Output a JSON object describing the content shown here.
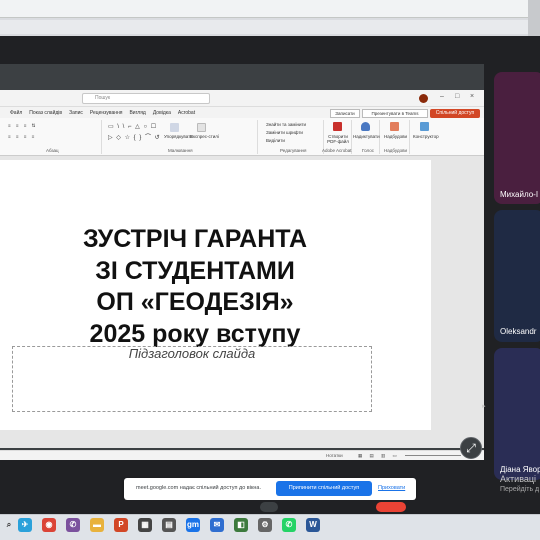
{
  "ppt": {
    "search_placeholder": "Пошук",
    "menu": [
      "Файл",
      "Показ слайдів",
      "Запис",
      "Рецензування",
      "Вигляд",
      "Довідка",
      "Acrobat"
    ],
    "record_label": "Записати",
    "present_teams_label": "Презентувати в Teams",
    "share_label": "Спільний доступ",
    "ribbon": {
      "paragraph_label": "Абзац",
      "drawing_label": "Малювання",
      "arrange_label": "Упорядкувати",
      "quick_styles_label": "Експрес-стилі",
      "find_replace": "Знайти та замінити",
      "replace_fonts": "Замінити шрифти",
      "select": "Виділити",
      "editing_label": "Редагування",
      "create_pdf": "Створити PDF-файл",
      "adobe_label": "Adobe Acrobat",
      "dictate": "Надиктувати",
      "voice_label": "Голос",
      "addins": "Надбудови",
      "addins_group": "Надбудови",
      "designer": "Конструктор"
    },
    "slide_title_lines": [
      "ЗУСТРІЧ ГАРАНТА",
      "ЗІ СТУДЕНТАМИ",
      "ОП «ГЕОДЕЗІЯ»",
      "2025 року вступу"
    ],
    "subtitle_placeholder": "Підзаголовок слайда",
    "status_notes": "Нотатки"
  },
  "participants": [
    {
      "name": "Михайло-І",
      "color": "#4a1f3f"
    },
    {
      "name": "Oleksandr",
      "color": "#1f2a44"
    },
    {
      "name": "Діана Явор",
      "color": "#2a2d55"
    }
  ],
  "activation": {
    "line1": "Активаці",
    "line2": "Перейдіть д"
  },
  "share_notice": {
    "text": "meet.google.com надає спільний доступ до вікна.",
    "stop_label": "Припинити спільний доступ",
    "hide_label": "Приховати"
  },
  "taskbar": {
    "apps": [
      {
        "name": "telegram-icon",
        "glyph": "✈",
        "color": "#2aa1da"
      },
      {
        "name": "chrome-icon",
        "glyph": "◉",
        "color": "#db4437"
      },
      {
        "name": "viber-icon",
        "glyph": "✆",
        "color": "#7b519d"
      },
      {
        "name": "file-explorer-icon",
        "glyph": "▬",
        "color": "#e8b23c"
      },
      {
        "name": "powerpoint-icon",
        "glyph": "P",
        "color": "#d24726"
      },
      {
        "name": "apps-icon",
        "glyph": "▦",
        "color": "#444444"
      },
      {
        "name": "calculator-icon",
        "glyph": "▤",
        "color": "#555555"
      },
      {
        "name": "meet-icon",
        "glyph": "gm",
        "color": "#1a73e8"
      },
      {
        "name": "mail-icon",
        "glyph": "✉",
        "color": "#2f6ed0"
      },
      {
        "name": "chat-icon",
        "glyph": "◧",
        "color": "#3d7a3d"
      },
      {
        "name": "settings-icon",
        "glyph": "⚙",
        "color": "#666666"
      },
      {
        "name": "whatsapp-icon",
        "glyph": "✆",
        "color": "#25d366"
      },
      {
        "name": "word-icon",
        "glyph": "W",
        "color": "#2b5797"
      }
    ]
  }
}
